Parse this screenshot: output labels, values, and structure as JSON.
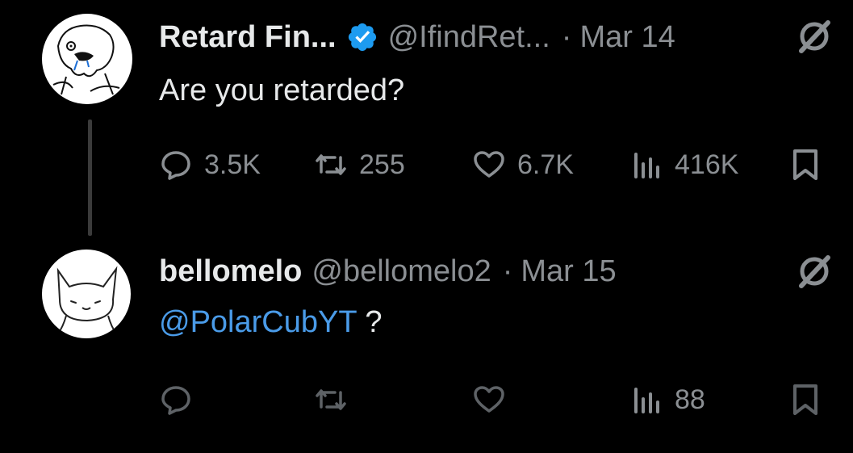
{
  "tweets": [
    {
      "author_name": "Retard Fin...",
      "verified": true,
      "handle": "@IfindRet...",
      "separator": "·",
      "date": "Mar 14",
      "text": "Are you retarded?",
      "replies": "3.5K",
      "reposts": "255",
      "likes": "6.7K",
      "views": "416K"
    },
    {
      "author_name": "bellomelo",
      "verified": false,
      "handle": "@bellomelo2",
      "separator": "·",
      "date": "Mar 15",
      "mention": "@PolarCubYT",
      "text_suffix": " ?",
      "replies": "",
      "reposts": "",
      "likes": "",
      "views": "88"
    }
  ],
  "colors": {
    "background": "#000000",
    "text": "#e7e9ea",
    "muted": "#8b8f93",
    "mention": "#4a9be8",
    "verified": "#1d9bf0"
  },
  "icons": [
    "reply-icon",
    "repost-icon",
    "like-icon",
    "views-icon",
    "bookmark-icon",
    "grok-icon",
    "verified-badge-icon"
  ]
}
